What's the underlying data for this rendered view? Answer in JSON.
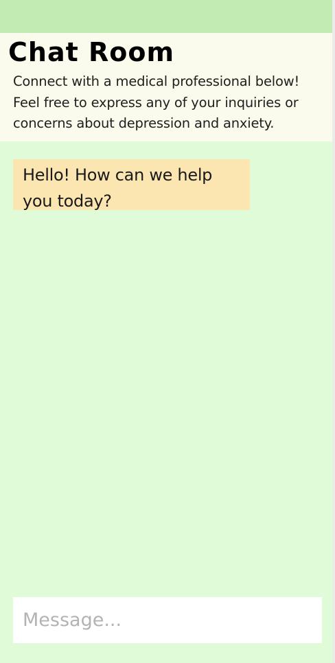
{
  "window": {
    "title": "Chat Room",
    "subtitle": "Connect with a medical professional below! Feel free to express any of your inquiries or concerns about depression and anxiety."
  },
  "messages": [
    {
      "sender": "professional",
      "text": "Hello! How can we help you today?"
    }
  ],
  "composer": {
    "value": "",
    "placeholder": "Message..."
  },
  "colors": {
    "top_bar": "#c2ebb3",
    "header_background": "#fafbec",
    "chat_background": "#e0fbd8",
    "bubble_background": "#fbe6b1",
    "input_background": "#ffffff"
  }
}
